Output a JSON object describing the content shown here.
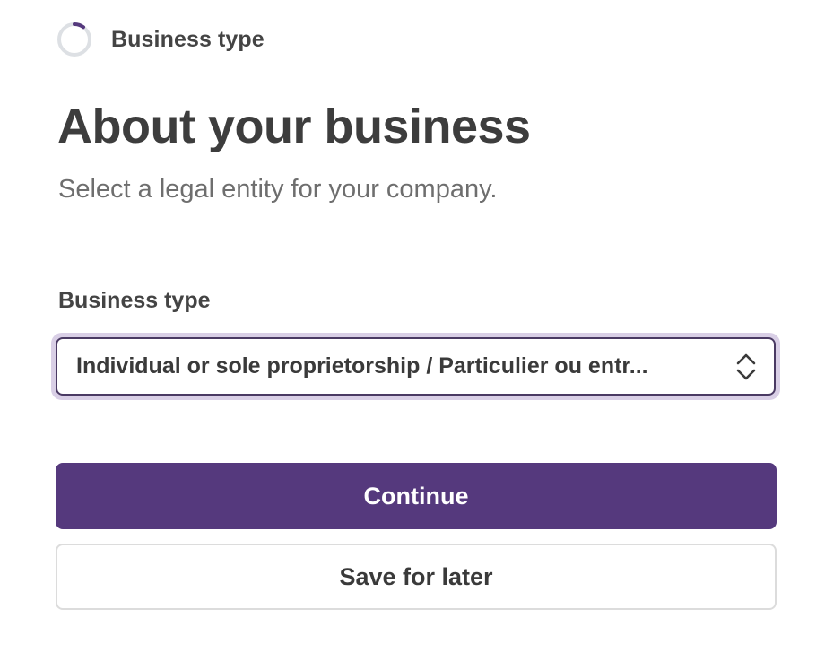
{
  "step": {
    "label": "Business type",
    "progress_fraction": 0.1,
    "progress_icon": "progress-ring-icon"
  },
  "header": {
    "title": "About your business",
    "subtitle": "Select a legal entity for your company."
  },
  "form": {
    "business_type_label": "Business type",
    "business_type_value": "Individual or sole proprietorship / Particulier ou entr...",
    "select_icon": "chevron-up-down-icon"
  },
  "actions": {
    "continue_label": "Continue",
    "save_later_label": "Save for later"
  },
  "colors": {
    "accent": "#55397d",
    "progress_track": "#dde0e4",
    "focus_ring": "#d9cfe6"
  }
}
